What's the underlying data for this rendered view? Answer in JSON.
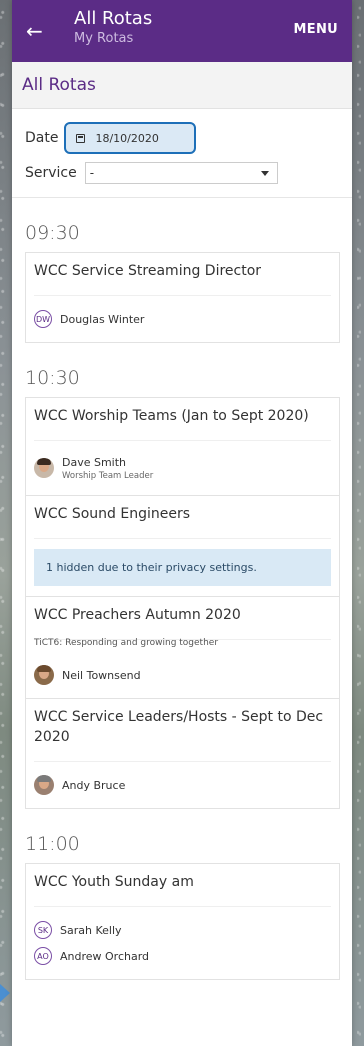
{
  "header": {
    "back_icon": "arrow-left-icon",
    "title": "All Rotas",
    "subtitle": "My Rotas",
    "menu_label": "MENU",
    "color": "#5b2c86"
  },
  "page_title": "All Rotas",
  "filters": {
    "date_label": "Date",
    "date_value": "18/10/2020",
    "service_label": "Service",
    "service_value": "-"
  },
  "slots": [
    {
      "time": "09:30",
      "rotas": [
        {
          "name": "WCC Service Streaming Director",
          "note": "",
          "people": [
            {
              "initials": "DW",
              "name": "Douglas Winter",
              "role": "",
              "photo": false
            }
          ],
          "hidden_message": ""
        }
      ]
    },
    {
      "time": "10:30",
      "rotas": [
        {
          "name": "WCC Worship Teams (Jan to Sept 2020)",
          "note": "",
          "people": [
            {
              "initials": "",
              "name": "Dave Smith",
              "role": "Worship Team Leader",
              "photo": true,
              "hair": "#3a2a20",
              "bg": "#c8b8a8"
            }
          ],
          "hidden_message": ""
        },
        {
          "name": "WCC Sound Engineers",
          "note": "",
          "people": [],
          "hidden_message": "1 hidden due to their privacy settings."
        },
        {
          "name": "WCC Preachers Autumn 2020",
          "note": "TiCT6: Responding and growing together",
          "people": [
            {
              "initials": "",
              "name": "Neil Townsend",
              "role": "",
              "photo": true,
              "hair": "#6b4a2e",
              "bg": "#8a6a4a"
            }
          ],
          "hidden_message": ""
        },
        {
          "name": "WCC Service Leaders/Hosts - Sept to Dec 2020",
          "note": "",
          "people": [
            {
              "initials": "",
              "name": "Andy Bruce",
              "role": "",
              "photo": true,
              "hair": "#7a7a7a",
              "bg": "#9a8070"
            }
          ],
          "hidden_message": ""
        }
      ]
    },
    {
      "time": "11:00",
      "rotas": [
        {
          "name": "WCC Youth Sunday am",
          "note": "",
          "people": [
            {
              "initials": "SK",
              "name": "Sarah Kelly",
              "role": "",
              "photo": false
            },
            {
              "initials": "AO",
              "name": "Andrew Orchard",
              "role": "",
              "photo": false
            }
          ],
          "hidden_message": ""
        }
      ]
    }
  ]
}
